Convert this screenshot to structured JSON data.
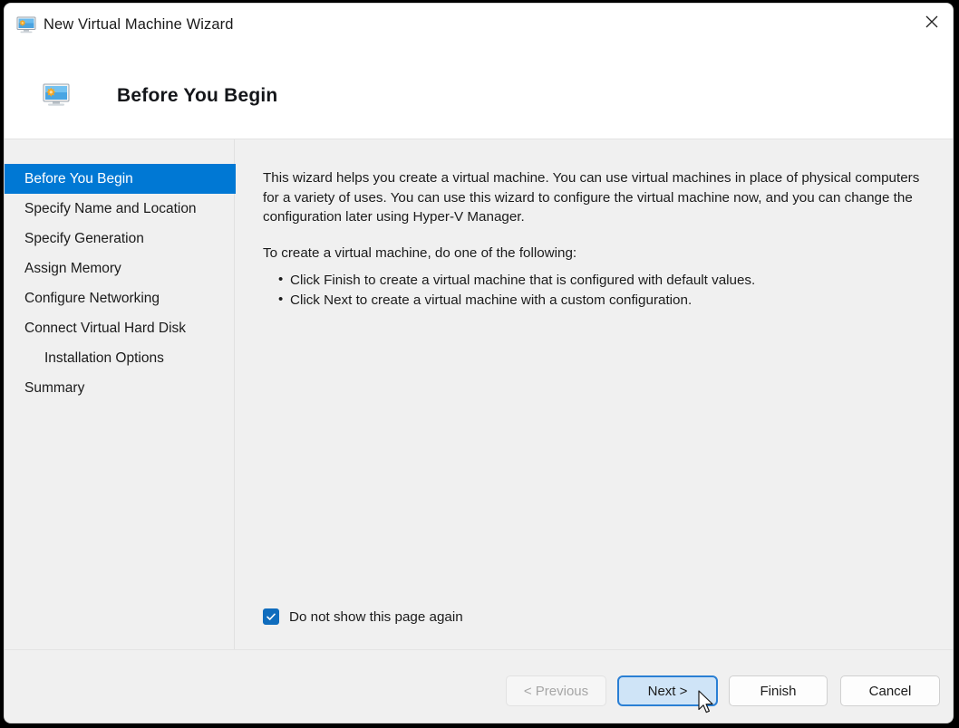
{
  "window": {
    "title": "New Virtual Machine Wizard",
    "title_icon": "virtual-machine-monitor-icon",
    "close_label": "×"
  },
  "header": {
    "title": "Before You Begin",
    "icon": "virtual-machine-monitor-icon"
  },
  "sidebar": {
    "items": [
      {
        "label": "Before You Begin",
        "selected": true,
        "indent": false
      },
      {
        "label": "Specify Name and Location",
        "selected": false,
        "indent": false
      },
      {
        "label": "Specify Generation",
        "selected": false,
        "indent": false
      },
      {
        "label": "Assign Memory",
        "selected": false,
        "indent": false
      },
      {
        "label": "Configure Networking",
        "selected": false,
        "indent": false
      },
      {
        "label": "Connect Virtual Hard Disk",
        "selected": false,
        "indent": false
      },
      {
        "label": "Installation Options",
        "selected": false,
        "indent": true
      },
      {
        "label": "Summary",
        "selected": false,
        "indent": false
      }
    ]
  },
  "content": {
    "paragraph_1": "This wizard helps you create a virtual machine. You can use virtual machines in place of physical computers for a variety of uses. You can use this wizard to configure the virtual machine now, and you can change the configuration later using Hyper-V Manager.",
    "paragraph_2": "To create a virtual machine, do one of the following:",
    "bullets": [
      "Click Finish to create a virtual machine that is configured with default values.",
      "Click Next to create a virtual machine with a custom configuration."
    ]
  },
  "checkbox": {
    "label": "Do not show this page again",
    "checked": true
  },
  "footer": {
    "buttons": [
      {
        "label": "< Previous",
        "state": "disabled"
      },
      {
        "label": "Next >",
        "state": "focused"
      },
      {
        "label": "Finish",
        "state": "normal"
      },
      {
        "label": "Cancel",
        "state": "normal"
      }
    ]
  },
  "colors": {
    "accent": "#0078d4",
    "focus_border": "#2a7fd4",
    "focus_fill": "#cfe4f7",
    "checkbox": "#0f6cbd",
    "panel_bg": "#f0f0f0",
    "titlebar_bg": "#ffffff"
  }
}
